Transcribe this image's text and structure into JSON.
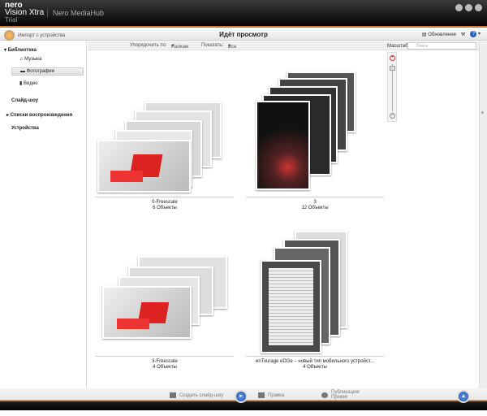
{
  "app": {
    "brand": "nero",
    "product": "Vision Xtra",
    "edition": "Trial",
    "title": "Nero MediaHub"
  },
  "toolbar": {
    "import": "Импорт с устройства",
    "page_title": "Идёт просмотр",
    "update": "Обновление"
  },
  "sidebar": {
    "library": "Библиотека",
    "music": "Музыка",
    "photos": "Фотографии",
    "video": "Видео",
    "slideshow": "Слайд-шоу",
    "playlists": "Списки воспроизведения",
    "devices": "Устройства"
  },
  "sortbar": {
    "sort_label": "Упорядочить по:",
    "sort_value": "Папкам",
    "show_label": "Показать:",
    "show_value": "Все"
  },
  "zoom": {
    "label": "Масштаб",
    "search_placeholder": "Поиск"
  },
  "items": [
    {
      "name": "0-Freescale",
      "count": "6 Объекты"
    },
    {
      "name": "3",
      "count": "12 Объекты"
    },
    {
      "name": "3-Freescale",
      "count": "4 Объекты"
    },
    {
      "name": "enTourage eDGe – новый тип мобильного устройст...",
      "count": "4 Объекты"
    }
  ],
  "bottom": {
    "slideshow": "Создать слайд-шоу",
    "edit": "Правка",
    "publish": "Публикация/ Прожиг"
  }
}
